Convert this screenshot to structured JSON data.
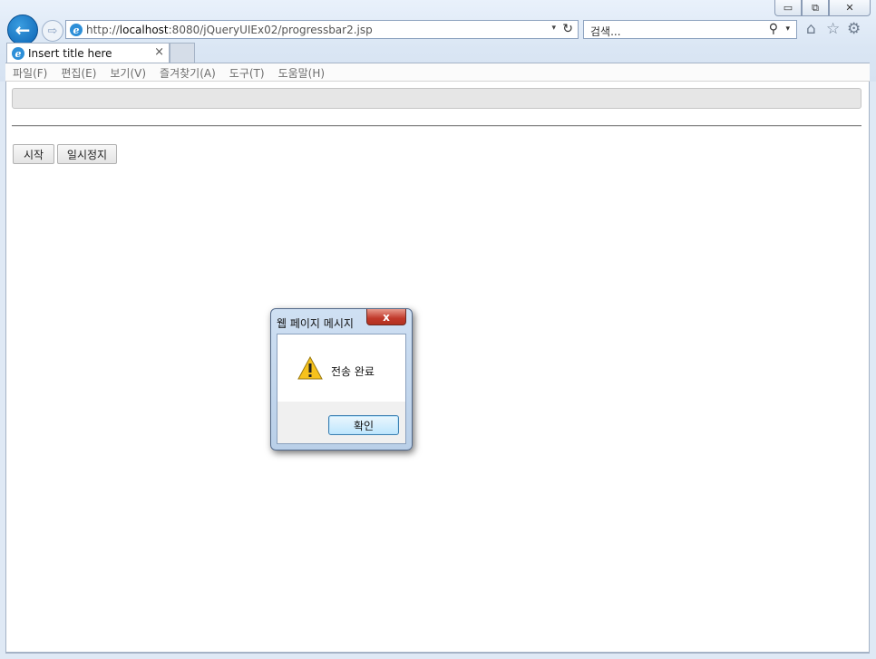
{
  "window": {
    "min_glyph": "▭",
    "max_glyph": "⧉",
    "close_glyph": "✕"
  },
  "nav": {
    "back_glyph": "←",
    "forward_glyph": "⇨"
  },
  "address": {
    "prefix": "http://",
    "host": "localhost",
    "rest": ":8080/jQueryUIEx02/progressbar2.jsp",
    "dropdown_glyph": "▾",
    "refresh_glyph": "↻"
  },
  "search": {
    "placeholder": "검색...",
    "search_glyph": "⚲",
    "dropdown_glyph": "▾"
  },
  "toolbar": {
    "home_glyph": "⌂",
    "favorites_glyph": "☆",
    "tools_glyph": "⚙"
  },
  "tab": {
    "title": "Insert title here",
    "close_glyph": "×",
    "favicon_glyph": "e"
  },
  "menu": [
    "파일(F)",
    "편집(E)",
    "보기(V)",
    "즐겨찾기(A)",
    "도구(T)",
    "도움말(H)"
  ],
  "page": {
    "progress_value": 0,
    "buttons": {
      "start": "시작",
      "pause": "일시정지"
    }
  },
  "dialog": {
    "title": "웹 페이지 메시지",
    "close_glyph": "x",
    "message": "전송 완료",
    "ok_label": "확인"
  }
}
